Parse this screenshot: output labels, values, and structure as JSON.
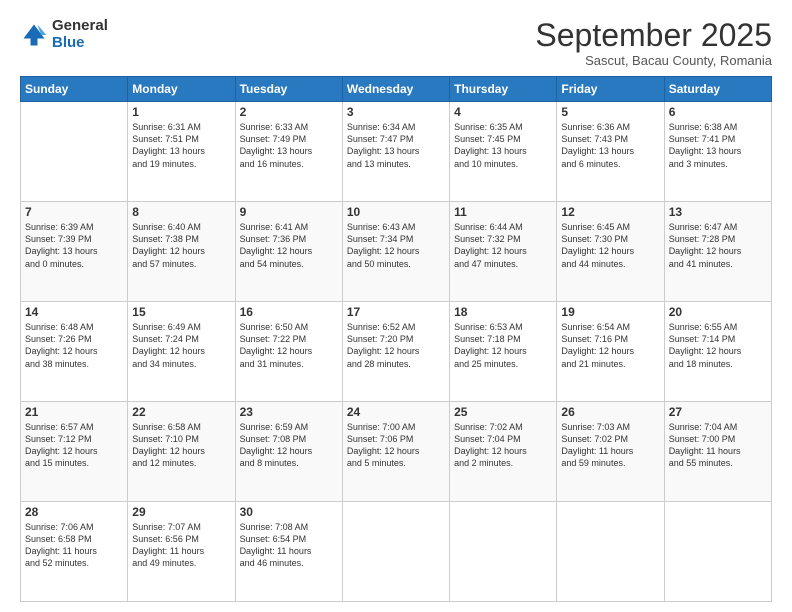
{
  "logo": {
    "general": "General",
    "blue": "Blue"
  },
  "header": {
    "month": "September 2025",
    "location": "Sascut, Bacau County, Romania"
  },
  "days_of_week": [
    "Sunday",
    "Monday",
    "Tuesday",
    "Wednesday",
    "Thursday",
    "Friday",
    "Saturday"
  ],
  "weeks": [
    [
      {
        "date": "",
        "info": ""
      },
      {
        "date": "1",
        "info": "Sunrise: 6:31 AM\nSunset: 7:51 PM\nDaylight: 13 hours\nand 19 minutes."
      },
      {
        "date": "2",
        "info": "Sunrise: 6:33 AM\nSunset: 7:49 PM\nDaylight: 13 hours\nand 16 minutes."
      },
      {
        "date": "3",
        "info": "Sunrise: 6:34 AM\nSunset: 7:47 PM\nDaylight: 13 hours\nand 13 minutes."
      },
      {
        "date": "4",
        "info": "Sunrise: 6:35 AM\nSunset: 7:45 PM\nDaylight: 13 hours\nand 10 minutes."
      },
      {
        "date": "5",
        "info": "Sunrise: 6:36 AM\nSunset: 7:43 PM\nDaylight: 13 hours\nand 6 minutes."
      },
      {
        "date": "6",
        "info": "Sunrise: 6:38 AM\nSunset: 7:41 PM\nDaylight: 13 hours\nand 3 minutes."
      }
    ],
    [
      {
        "date": "7",
        "info": "Sunrise: 6:39 AM\nSunset: 7:39 PM\nDaylight: 13 hours\nand 0 minutes."
      },
      {
        "date": "8",
        "info": "Sunrise: 6:40 AM\nSunset: 7:38 PM\nDaylight: 12 hours\nand 57 minutes."
      },
      {
        "date": "9",
        "info": "Sunrise: 6:41 AM\nSunset: 7:36 PM\nDaylight: 12 hours\nand 54 minutes."
      },
      {
        "date": "10",
        "info": "Sunrise: 6:43 AM\nSunset: 7:34 PM\nDaylight: 12 hours\nand 50 minutes."
      },
      {
        "date": "11",
        "info": "Sunrise: 6:44 AM\nSunset: 7:32 PM\nDaylight: 12 hours\nand 47 minutes."
      },
      {
        "date": "12",
        "info": "Sunrise: 6:45 AM\nSunset: 7:30 PM\nDaylight: 12 hours\nand 44 minutes."
      },
      {
        "date": "13",
        "info": "Sunrise: 6:47 AM\nSunset: 7:28 PM\nDaylight: 12 hours\nand 41 minutes."
      }
    ],
    [
      {
        "date": "14",
        "info": "Sunrise: 6:48 AM\nSunset: 7:26 PM\nDaylight: 12 hours\nand 38 minutes."
      },
      {
        "date": "15",
        "info": "Sunrise: 6:49 AM\nSunset: 7:24 PM\nDaylight: 12 hours\nand 34 minutes."
      },
      {
        "date": "16",
        "info": "Sunrise: 6:50 AM\nSunset: 7:22 PM\nDaylight: 12 hours\nand 31 minutes."
      },
      {
        "date": "17",
        "info": "Sunrise: 6:52 AM\nSunset: 7:20 PM\nDaylight: 12 hours\nand 28 minutes."
      },
      {
        "date": "18",
        "info": "Sunrise: 6:53 AM\nSunset: 7:18 PM\nDaylight: 12 hours\nand 25 minutes."
      },
      {
        "date": "19",
        "info": "Sunrise: 6:54 AM\nSunset: 7:16 PM\nDaylight: 12 hours\nand 21 minutes."
      },
      {
        "date": "20",
        "info": "Sunrise: 6:55 AM\nSunset: 7:14 PM\nDaylight: 12 hours\nand 18 minutes."
      }
    ],
    [
      {
        "date": "21",
        "info": "Sunrise: 6:57 AM\nSunset: 7:12 PM\nDaylight: 12 hours\nand 15 minutes."
      },
      {
        "date": "22",
        "info": "Sunrise: 6:58 AM\nSunset: 7:10 PM\nDaylight: 12 hours\nand 12 minutes."
      },
      {
        "date": "23",
        "info": "Sunrise: 6:59 AM\nSunset: 7:08 PM\nDaylight: 12 hours\nand 8 minutes."
      },
      {
        "date": "24",
        "info": "Sunrise: 7:00 AM\nSunset: 7:06 PM\nDaylight: 12 hours\nand 5 minutes."
      },
      {
        "date": "25",
        "info": "Sunrise: 7:02 AM\nSunset: 7:04 PM\nDaylight: 12 hours\nand 2 minutes."
      },
      {
        "date": "26",
        "info": "Sunrise: 7:03 AM\nSunset: 7:02 PM\nDaylight: 11 hours\nand 59 minutes."
      },
      {
        "date": "27",
        "info": "Sunrise: 7:04 AM\nSunset: 7:00 PM\nDaylight: 11 hours\nand 55 minutes."
      }
    ],
    [
      {
        "date": "28",
        "info": "Sunrise: 7:06 AM\nSunset: 6:58 PM\nDaylight: 11 hours\nand 52 minutes."
      },
      {
        "date": "29",
        "info": "Sunrise: 7:07 AM\nSunset: 6:56 PM\nDaylight: 11 hours\nand 49 minutes."
      },
      {
        "date": "30",
        "info": "Sunrise: 7:08 AM\nSunset: 6:54 PM\nDaylight: 11 hours\nand 46 minutes."
      },
      {
        "date": "",
        "info": ""
      },
      {
        "date": "",
        "info": ""
      },
      {
        "date": "",
        "info": ""
      },
      {
        "date": "",
        "info": ""
      }
    ]
  ]
}
